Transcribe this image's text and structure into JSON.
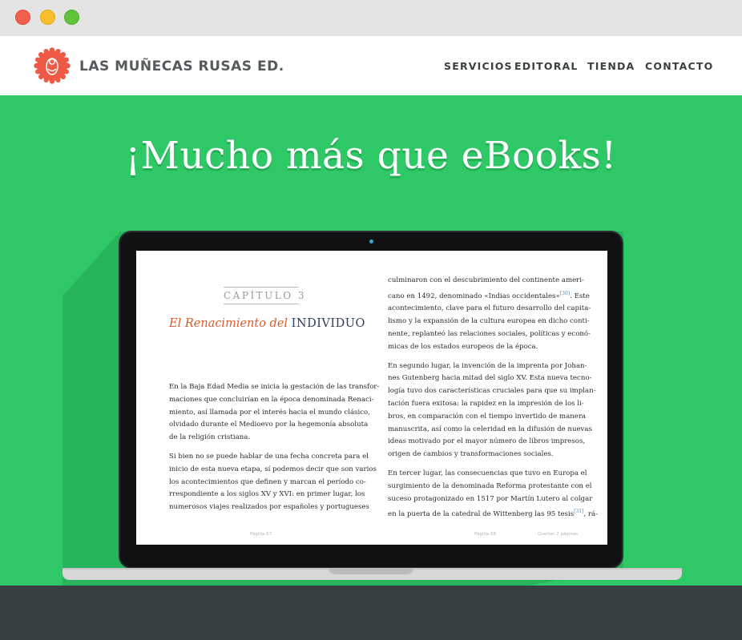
{
  "header": {
    "brand": "LAS MUÑECAS RUSAS ED.",
    "nav": [
      "SERVICIOS",
      "EDITORAL",
      "TIENDA",
      "CONTACTO"
    ]
  },
  "hero": {
    "headline": "¡Mucho más que eBooks!"
  },
  "book": {
    "chapter_label": "CAPÍTULO 3",
    "title_italic": "El Renacimiento del",
    "title_caps": "INDIVIDUO",
    "left_paragraphs": [
      [
        "En la Baja Edad Media se inicia la gestación de las transfor-",
        "maciones que concluirían en la época denominada Renaci-",
        "miento, así llamada por el interés hacia el mundo clásico,",
        "olvidado durante el Medioevo por la hegemonía absoluta",
        "de la religión cristiana."
      ],
      [
        "Si bien no se puede hablar de una fecha concreta para el",
        "inicio de esta nueva etapa, sí podemos decir que son varios",
        "los acontecimientos que definen y marcan el período co-",
        "rrespondiente a los siglos XV y XVI: en primer lugar, los",
        "numerosos viajes realizados por españoles y portugueses"
      ]
    ],
    "right_paragraphs": [
      [
        "culminaron con el descubrimiento del continente ameri-",
        "cano en 1492, denominado «Indias occidentales»[30]. Este",
        "acontecimiento, clave para el futuro desarrollo del capita-",
        "lismo y la expansión de la cultura europea en dicho conti-",
        "nente, replanteó las relaciones sociales, políticas y econó-",
        "micas de los estados europeos de la época."
      ],
      [
        "En segundo lugar, la invención de la imprenta por Johan-",
        "nes Gutenberg hacia mitad del siglo XV. Esta nueva tecno-",
        "logía tuvo dos características cruciales para que su implan-",
        "tación fuera exitosa: la rapidez en la impresión de los li-",
        "bros, en comparación con el tiempo invertido de manera",
        "manuscrita, así como la celeridad en la difusión de nuevas",
        "ideas motivado por el mayor número de libros impresos,",
        "origen de cambios y transformaciones sociales."
      ],
      [
        "En tercer lugar, las consecuencias que tuvo en Europa el",
        "surgimiento de la denominada Reforma protestante con el",
        "suceso protagonizado en 1517 por Martín Lutero al colgar",
        "en la puerta de la catedral de Wittenberg las 95 tesis[31], rá-"
      ]
    ],
    "page_left": "Página 67",
    "page_right": "Página 68",
    "pages_remaining": "Quedan 2 páginas"
  },
  "colors": {
    "hero_green": "#2fc866",
    "accent_orange": "#d95a2b",
    "footer": "#383f41"
  }
}
